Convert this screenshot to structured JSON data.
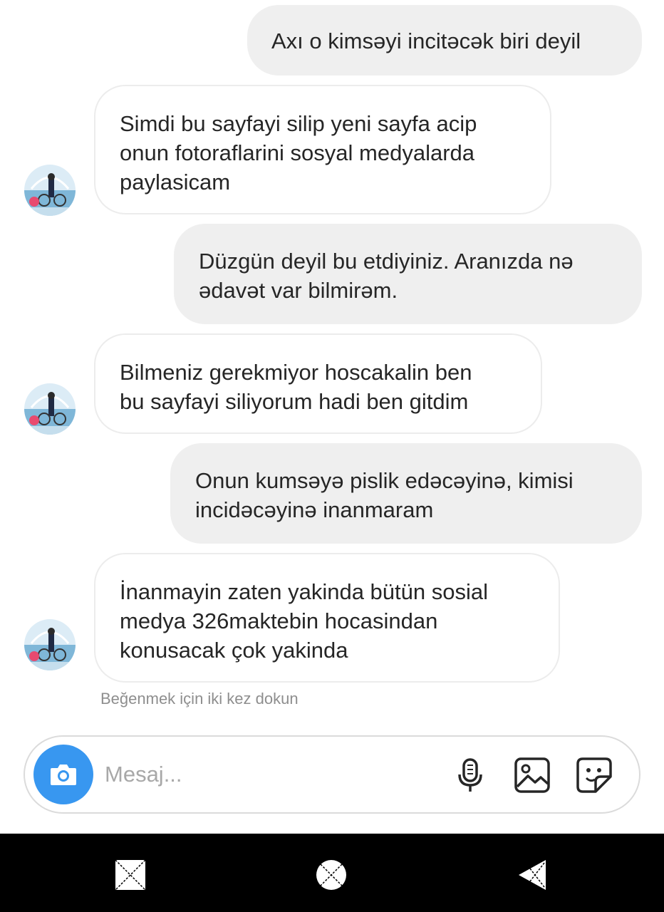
{
  "messages": [
    {
      "direction": "sent",
      "text": "Axı o kimsəyi incitəcək biri deyil"
    },
    {
      "direction": "received",
      "text": "Simdi bu sayfayi silip yeni sayfa acip\nonun fotoraflarini sosyal medyalarda\npaylasicam"
    },
    {
      "direction": "sent",
      "text": "Düzgün deyil bu etdiyiniz. Aranızda nə\nədavət var bilmirəm."
    },
    {
      "direction": "received",
      "text": "Bilmeniz gerekmiyor hoscakalin ben\nbu sayfayi siliyorum hadi ben gitdim"
    },
    {
      "direction": "sent",
      "text": "Onun kumsəyə pislik edəcəyinə, kimisi\nincidəcəyinə inanmaram"
    },
    {
      "direction": "received",
      "text": "İnanmayin zaten yakinda bütün sosial\nmedya 326maktebin hocasindan\nkonusacak çok yakinda"
    }
  ],
  "hint": "Beğenmek için iki kez dokun",
  "composer": {
    "placeholder": "Mesaj...",
    "camera_icon": "camera-icon",
    "tools": [
      "microphone-icon",
      "gallery-icon",
      "sticker-icon"
    ]
  },
  "navbar": {
    "buttons": [
      "recent-apps-icon",
      "home-icon",
      "back-icon"
    ]
  },
  "colors": {
    "sent_bubble": "#efefef",
    "received_border": "#ececec",
    "accent": "#3897f0",
    "text": "#262626",
    "hint": "#8e8e8e"
  }
}
